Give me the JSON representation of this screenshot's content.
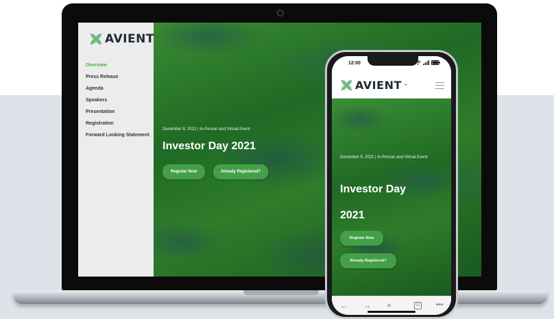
{
  "brand": {
    "logo_text": "AVIENT",
    "tm": "™",
    "accent_color": "#4eb049",
    "button_color": "#43a047"
  },
  "desktop": {
    "nav": [
      {
        "label": "Overview",
        "active": true
      },
      {
        "label": "Press Release"
      },
      {
        "label": "Agenda"
      },
      {
        "label": "Speakers"
      },
      {
        "label": "Presentation"
      },
      {
        "label": "Registration"
      },
      {
        "label": "Forward Looking Statement"
      }
    ],
    "hero": {
      "date": "December 9, 2021 | In-Person and Virtual Event",
      "title": "Investor Day 2021",
      "buttons": {
        "register": "Register Now",
        "registered": "Already Registered?"
      }
    }
  },
  "phone": {
    "status": {
      "time": "12:00",
      "icons": "wifi-icon signal-icon battery-icon"
    },
    "hero": {
      "date": "December 9, 2021 | In-Person and Virtual Event",
      "title": "Investor Day 2021",
      "buttons": {
        "register": "Register Now",
        "registered": "Already Registered?"
      }
    },
    "browser_bar": {
      "back": "←",
      "forward": "→",
      "new_tab": "+",
      "tabs": "21",
      "more": "•••"
    }
  }
}
